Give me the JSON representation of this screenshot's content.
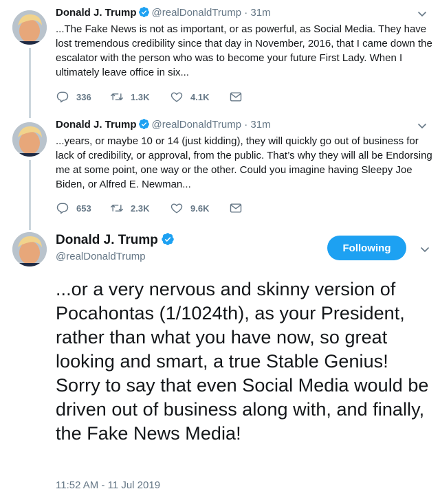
{
  "colors": {
    "accent": "#1da1f2",
    "text": "#14171a",
    "muted": "#657786",
    "thread_line": "#ccd6dd"
  },
  "tweets": [
    {
      "name": "Donald J. Trump",
      "handle": "@realDonaldTrump",
      "separator": "·",
      "time": "31m",
      "text": "...The Fake News is not as important, or as powerful, as Social Media. They have lost tremendous credibility since that day in November, 2016, that I came down the escalator with the person who was to become your future First Lady. When I ultimately leave office in six...",
      "replies": "336",
      "retweets": "1.3K",
      "likes": "4.1K"
    },
    {
      "name": "Donald J. Trump",
      "handle": "@realDonaldTrump",
      "separator": "·",
      "time": "31m",
      "text": "...years, or maybe 10 or 14 (just kidding), they will quickly go out of business for lack of credibility, or approval, from the public. That’s why they will all be Endorsing me at some point, one way or the other. Could you imagine having Sleepy Joe Biden, or Alfred E. Newman...",
      "replies": "653",
      "retweets": "2.3K",
      "likes": "9.6K"
    }
  ],
  "main_tweet": {
    "name": "Donald J. Trump",
    "handle": "@realDonaldTrump",
    "follow_label": "Following",
    "text": "...or a very nervous and skinny version of Pocahontas (1/1024th), as your President, rather than what you have now, so great looking and smart, a true Stable Genius! Sorry to say that even Social Media would be driven out of business along with, and finally, the Fake News Media!",
    "timestamp": "11:52 AM - 11 Jul 2019"
  },
  "icons": {
    "verified": "verified-badge-icon",
    "menu": "chevron-down-icon",
    "reply": "reply-icon",
    "retweet": "retweet-icon",
    "like": "heart-icon",
    "dm": "envelope-icon"
  }
}
